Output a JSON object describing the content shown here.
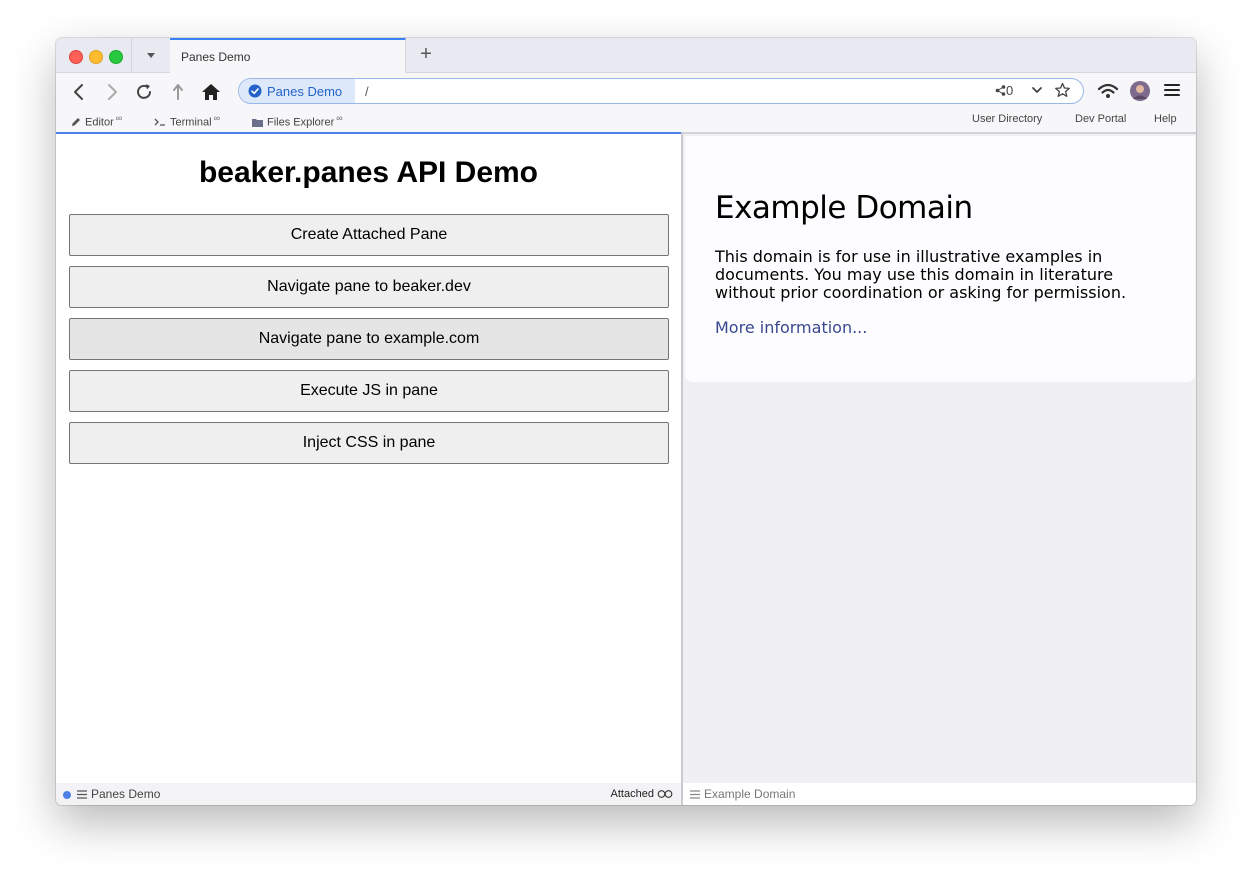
{
  "tab": {
    "title": "Panes Demo"
  },
  "address": {
    "site_label": "Panes Demo",
    "path": "/",
    "share_count": "0"
  },
  "bookmarks": {
    "left": [
      {
        "label": "Editor",
        "mark": "∞"
      },
      {
        "label": "Terminal",
        "mark": "∞"
      },
      {
        "label": "Files Explorer",
        "mark": "∞"
      }
    ],
    "right": [
      "User Directory",
      "Dev Portal",
      "Help"
    ]
  },
  "left_pane": {
    "title": "beaker.panes API Demo",
    "buttons": [
      "Create Attached Pane",
      "Navigate pane to beaker.dev",
      "Navigate pane to example.com",
      "Execute JS in pane",
      "Inject CSS in pane"
    ],
    "status_label": "Panes Demo",
    "status_right": "Attached"
  },
  "right_pane": {
    "title": "Example Domain",
    "paragraph": "This domain is for use in illustrative examples in documents. You may use this domain in literature without prior coordination or asking for permission.",
    "link": "More information...",
    "status_label": "Example Domain"
  },
  "colors": {
    "accent": "#4f80e8",
    "link": "#38488f",
    "site_pill": "#dde9fb"
  }
}
